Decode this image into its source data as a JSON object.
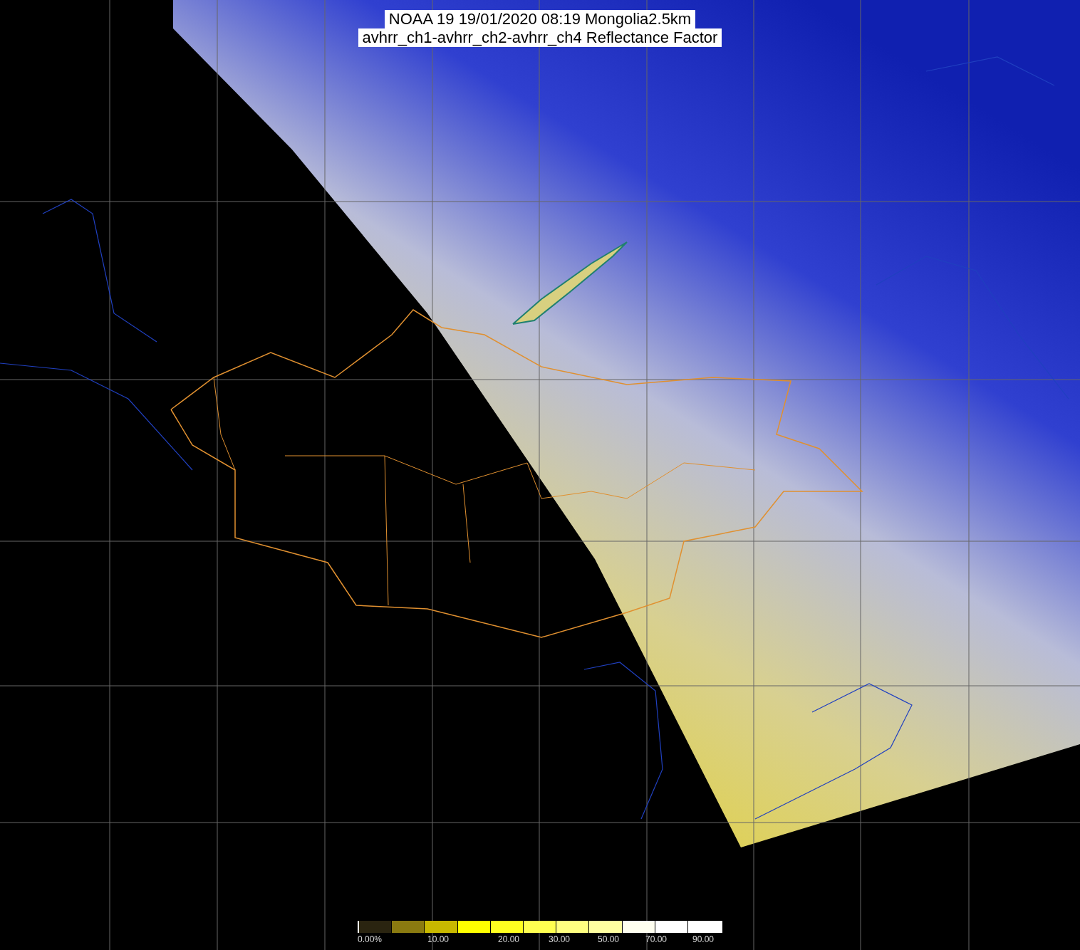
{
  "title": {
    "lines": [
      "NOAA 19 19/01/2020 08:19 Mongolia2.5km",
      "avhrr_ch1-avhrr_ch2-avhrr_ch4 Reflectance Factor"
    ]
  },
  "legend": {
    "ticks": [
      "0.00%",
      "10.00",
      "20.00",
      "30.00",
      "50.00",
      "70.00",
      "90.00"
    ]
  }
}
